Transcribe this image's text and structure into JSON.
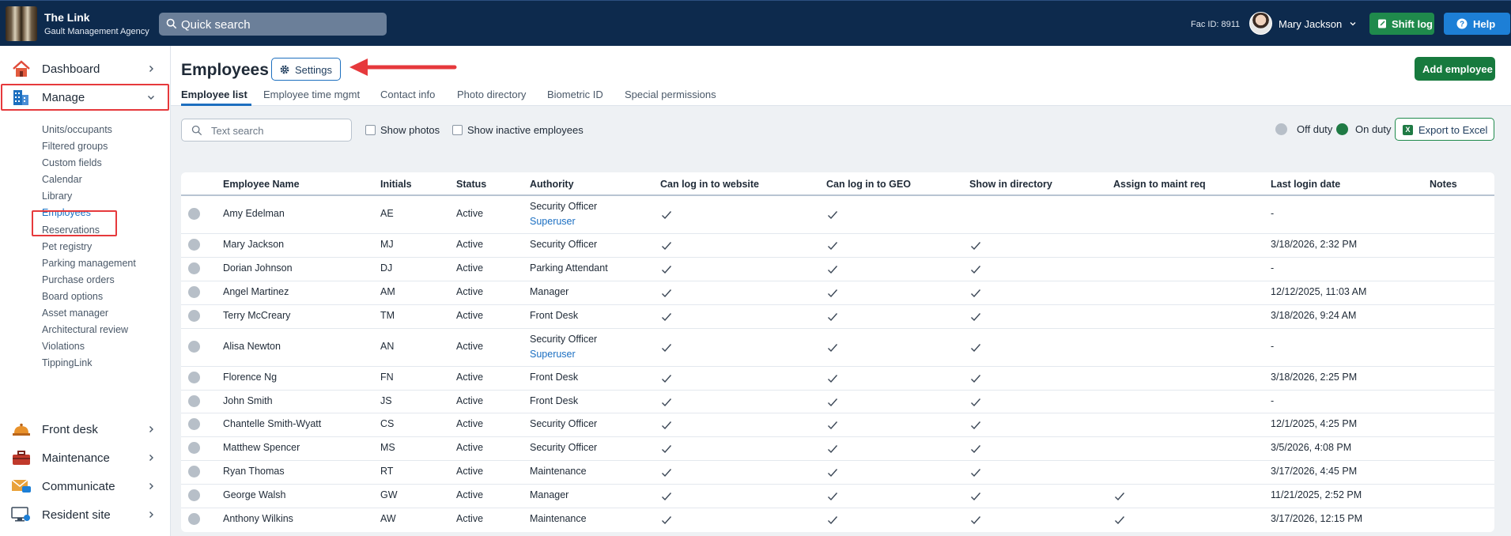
{
  "brand": {
    "title": "The Link",
    "subtitle": "Gault Management Agency"
  },
  "topbar": {
    "search_placeholder": "Quick search",
    "fac_id": "Fac ID: 8911",
    "user_name": "Mary Jackson",
    "shift_log": "Shift log",
    "help": "Help"
  },
  "sidebar": {
    "main": [
      {
        "label": "Dashboard",
        "icon": "house-icon"
      },
      {
        "label": "Manage",
        "icon": "building-icon",
        "expanded": true
      },
      {
        "label": "Front desk",
        "icon": "bell-icon"
      },
      {
        "label": "Maintenance",
        "icon": "toolbox-icon"
      },
      {
        "label": "Communicate",
        "icon": "envelope-icon"
      },
      {
        "label": "Resident site",
        "icon": "monitor-icon"
      }
    ],
    "manage_items": [
      "Units/occupants",
      "Filtered groups",
      "Custom fields",
      "Calendar",
      "Library",
      "Employees",
      "Reservations",
      "Pet registry",
      "Parking management",
      "Purchase orders",
      "Board options",
      "Asset manager",
      "Architectural review",
      "Violations",
      "TippingLink"
    ],
    "active_item": "Employees"
  },
  "page": {
    "title": "Employees",
    "settings": "Settings",
    "add_employee": "Add employee",
    "tabs": [
      "Employee list",
      "Employee time mgmt",
      "Contact info",
      "Photo directory",
      "Biometric ID",
      "Special permissions"
    ],
    "active_tab": "Employee list"
  },
  "toolbar": {
    "text_search_placeholder": "Text search",
    "show_photos": "Show photos",
    "show_inactive": "Show inactive employees",
    "off_duty": "Off duty",
    "on_duty": "On duty",
    "export": "Export to Excel",
    "colors": {
      "off_duty": "#b7bfc8",
      "on_duty": "#1f7a44"
    }
  },
  "table": {
    "columns": [
      "Employee Name",
      "Initials",
      "Status",
      "Authority",
      "Can log in to website",
      "Can log in to GEO",
      "Show in directory",
      "Assign to maint req",
      "Last login date",
      "Notes"
    ],
    "rows": [
      {
        "name": "Amy Edelman",
        "initials": "AE",
        "status": "Active",
        "authority": "Security Officer",
        "authority2": "Superuser",
        "web": true,
        "geo": true,
        "dir": false,
        "maint": false,
        "last": "-",
        "notes": ""
      },
      {
        "name": "Mary Jackson",
        "initials": "MJ",
        "status": "Active",
        "authority": "Security Officer",
        "authority2": "",
        "web": true,
        "geo": true,
        "dir": true,
        "maint": false,
        "last": "3/18/2026, 2:32 PM",
        "notes": ""
      },
      {
        "name": "Dorian Johnson",
        "initials": "DJ",
        "status": "Active",
        "authority": "Parking Attendant",
        "authority2": "",
        "web": true,
        "geo": true,
        "dir": true,
        "maint": false,
        "last": "-",
        "notes": ""
      },
      {
        "name": "Angel Martinez",
        "initials": "AM",
        "status": "Active",
        "authority": "Manager",
        "authority2": "",
        "web": true,
        "geo": true,
        "dir": true,
        "maint": false,
        "last": "12/12/2025, 11:03 AM",
        "notes": ""
      },
      {
        "name": "Terry McCreary",
        "initials": "TM",
        "status": "Active",
        "authority": "Front Desk",
        "authority2": "",
        "web": true,
        "geo": true,
        "dir": true,
        "maint": false,
        "last": "3/18/2026, 9:24 AM",
        "notes": ""
      },
      {
        "name": "Alisa Newton",
        "initials": "AN",
        "status": "Active",
        "authority": "Security Officer",
        "authority2": "Superuser",
        "web": true,
        "geo": true,
        "dir": true,
        "maint": false,
        "last": "-",
        "notes": ""
      },
      {
        "name": "Florence Ng",
        "initials": "FN",
        "status": "Active",
        "authority": "Front Desk",
        "authority2": "",
        "web": true,
        "geo": true,
        "dir": true,
        "maint": false,
        "last": "3/18/2026, 2:25 PM",
        "notes": ""
      },
      {
        "name": "John Smith",
        "initials": "JS",
        "status": "Active",
        "authority": "Front Desk",
        "authority2": "",
        "web": true,
        "geo": true,
        "dir": true,
        "maint": false,
        "last": "-",
        "notes": ""
      },
      {
        "name": "Chantelle Smith-Wyatt",
        "initials": "CS",
        "status": "Active",
        "authority": "Security Officer",
        "authority2": "",
        "web": true,
        "geo": true,
        "dir": true,
        "maint": false,
        "last": "12/1/2025, 4:25 PM",
        "notes": ""
      },
      {
        "name": "Matthew Spencer",
        "initials": "MS",
        "status": "Active",
        "authority": "Security Officer",
        "authority2": "",
        "web": true,
        "geo": true,
        "dir": true,
        "maint": false,
        "last": "3/5/2026, 4:08 PM",
        "notes": ""
      },
      {
        "name": "Ryan Thomas",
        "initials": "RT",
        "status": "Active",
        "authority": "Maintenance",
        "authority2": "",
        "web": true,
        "geo": true,
        "dir": true,
        "maint": false,
        "last": "3/17/2026, 4:45 PM",
        "notes": ""
      },
      {
        "name": "George Walsh",
        "initials": "GW",
        "status": "Active",
        "authority": "Manager",
        "authority2": "",
        "web": true,
        "geo": true,
        "dir": true,
        "maint": true,
        "last": "11/21/2025, 2:52 PM",
        "notes": ""
      },
      {
        "name": "Anthony Wilkins",
        "initials": "AW",
        "status": "Active",
        "authority": "Maintenance",
        "authority2": "",
        "web": true,
        "geo": true,
        "dir": true,
        "maint": true,
        "last": "3/17/2026, 12:15 PM",
        "notes": ""
      }
    ]
  }
}
